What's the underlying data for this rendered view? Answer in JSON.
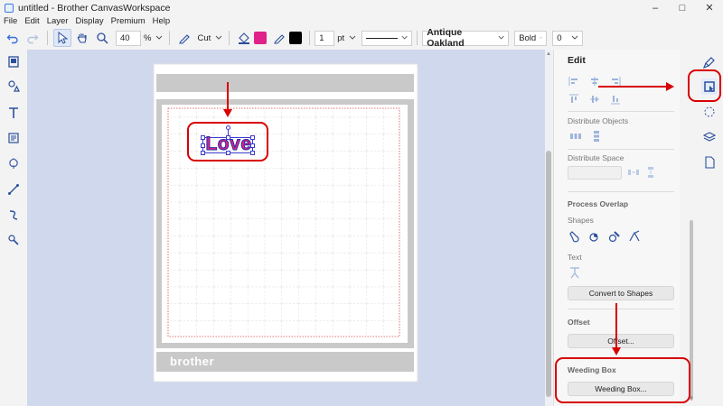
{
  "window": {
    "title": "untitled - Brother CanvasWorkspace"
  },
  "menu": [
    "File",
    "Edit",
    "Layer",
    "Display",
    "Premium",
    "Help"
  ],
  "toolbar": {
    "zoom": "40",
    "zoom_unit": "%",
    "mode": "Cut",
    "line_width": "1",
    "line_unit": "pt",
    "font": "Antique Oakland",
    "weight": "Bold",
    "spacing": "0",
    "fill_color": "#e0218a",
    "line_color": "#000000"
  },
  "canvas": {
    "text_object": "Love",
    "mat_brand": "brother"
  },
  "panel": {
    "title": "Edit",
    "distribute_objects": "Distribute Objects",
    "distribute_space": "Distribute Space",
    "distribute_space_value": "",
    "process_overlap": "Process Overlap",
    "shapes": "Shapes",
    "text": "Text",
    "convert_to_shapes": "Convert to Shapes",
    "offset": "Offset",
    "offset_button": "Offset...",
    "weeding_box": "Weeding Box",
    "weeding_box_button": "Weeding Box..."
  },
  "colors": {
    "accent": "#3a6fd8",
    "annotation": "#d80000",
    "canvas_bg": "#d0d8ed"
  }
}
